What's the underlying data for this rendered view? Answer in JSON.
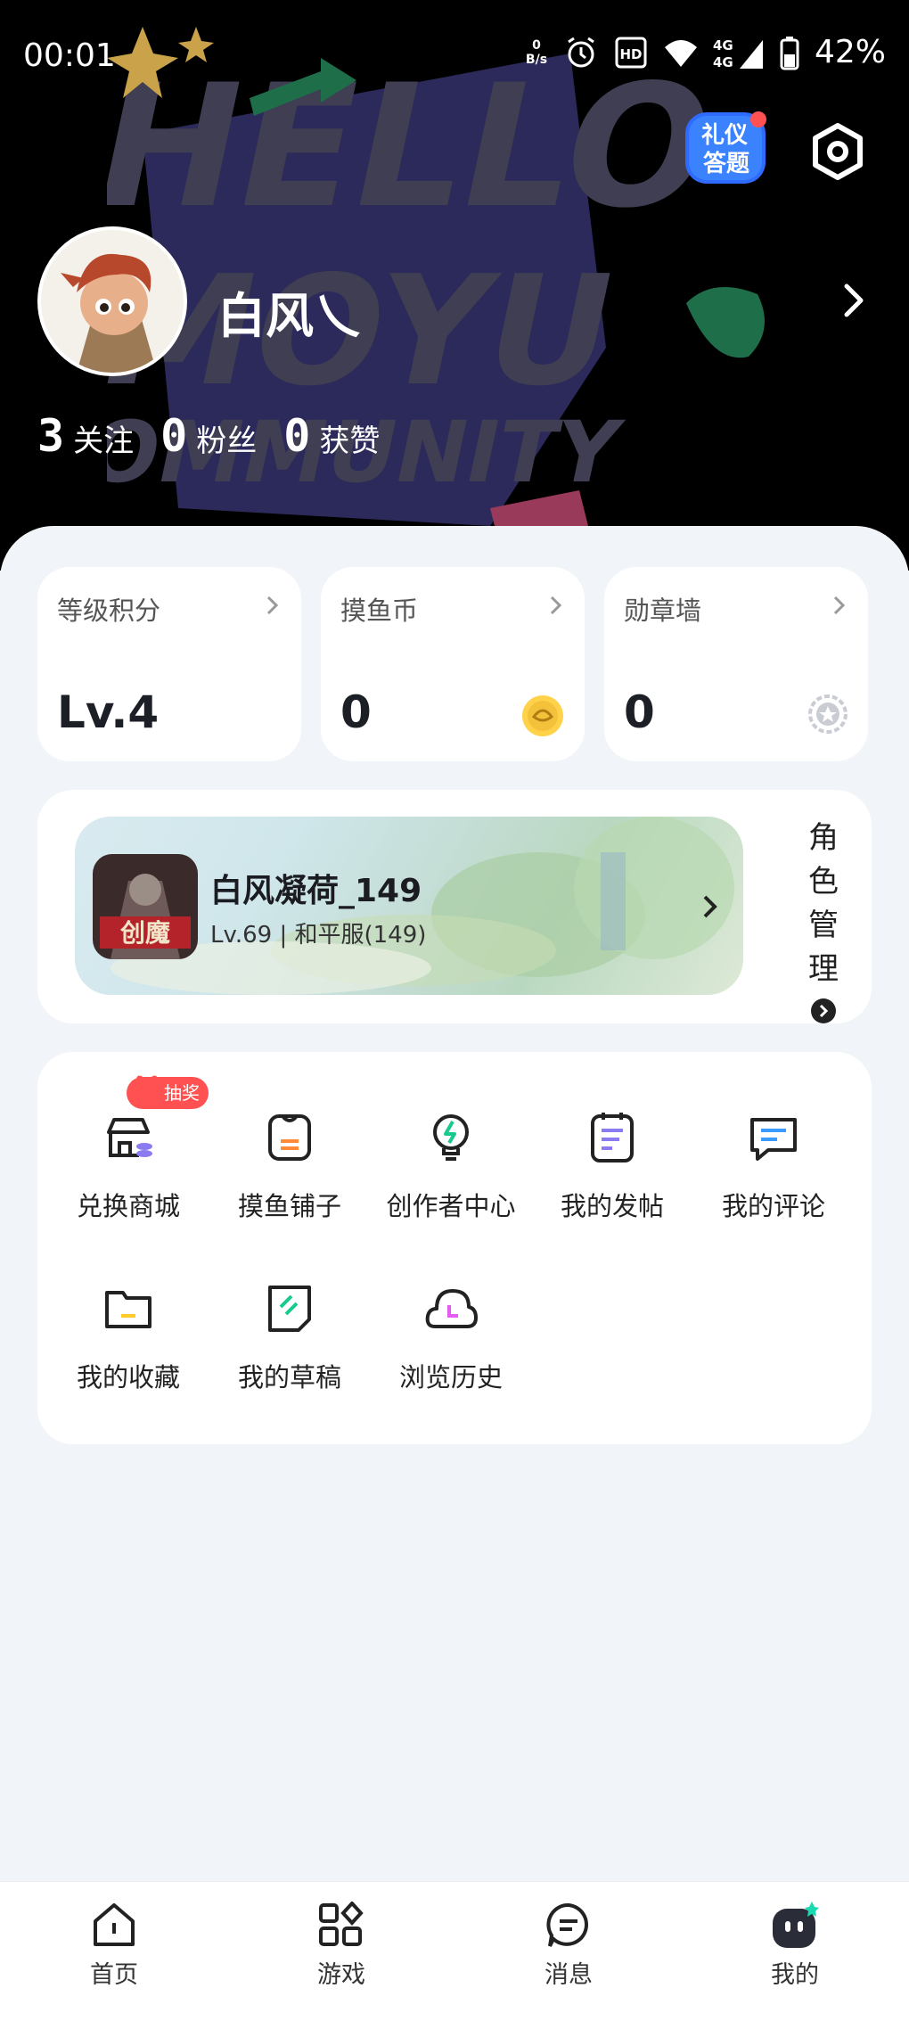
{
  "status_bar": {
    "time": "00:01",
    "net_speed_value": "0",
    "net_speed_unit": "B/s",
    "battery": "42%",
    "icons": [
      "alarm-icon",
      "hd-icon",
      "wifi-icon",
      "4g-signal-icon",
      "battery-icon"
    ]
  },
  "header": {
    "background_art_text": "HELLO MOYU COMMUNITY",
    "quiz_badge_label": "礼仪答题",
    "username": "白风乀",
    "stats": [
      {
        "value": "3",
        "label": "关注"
      },
      {
        "value": "0",
        "label": "粉丝"
      },
      {
        "value": "0",
        "label": "获赞"
      }
    ]
  },
  "cards": [
    {
      "title": "等级积分",
      "value": "Lv.4"
    },
    {
      "title": "摸鱼币",
      "value": "0",
      "icon": "coin-icon"
    },
    {
      "title": "勋章墙",
      "value": "0",
      "icon": "medal-icon"
    }
  ],
  "role": {
    "name": "白风凝荷_149",
    "sub": "Lv.69 | 和平服(149)",
    "game_icon_text": "创魔",
    "manage_label": "角色管理"
  },
  "menu": {
    "lottery_badge": "抽奖",
    "items": [
      {
        "label": "兑换商城",
        "icon": "shop-icon"
      },
      {
        "label": "摸鱼铺子",
        "icon": "bag-icon"
      },
      {
        "label": "创作者中心",
        "icon": "bulb-icon"
      },
      {
        "label": "我的发帖",
        "icon": "notepad-icon"
      },
      {
        "label": "我的评论",
        "icon": "comment-icon"
      },
      {
        "label": "我的收藏",
        "icon": "folder-icon"
      },
      {
        "label": "我的草稿",
        "icon": "draft-icon"
      },
      {
        "label": "浏览历史",
        "icon": "history-icon"
      }
    ]
  },
  "nav": {
    "items": [
      {
        "label": "首页",
        "icon": "home-icon"
      },
      {
        "label": "游戏",
        "icon": "games-icon"
      },
      {
        "label": "消息",
        "icon": "message-icon"
      },
      {
        "label": "我的",
        "icon": "profile-icon",
        "active": true
      }
    ]
  },
  "colors": {
    "accent": "#2a2c38",
    "lottery_badge": "#ff5151",
    "page_bg": "#f1f4f8",
    "header_bg": "#000000"
  }
}
